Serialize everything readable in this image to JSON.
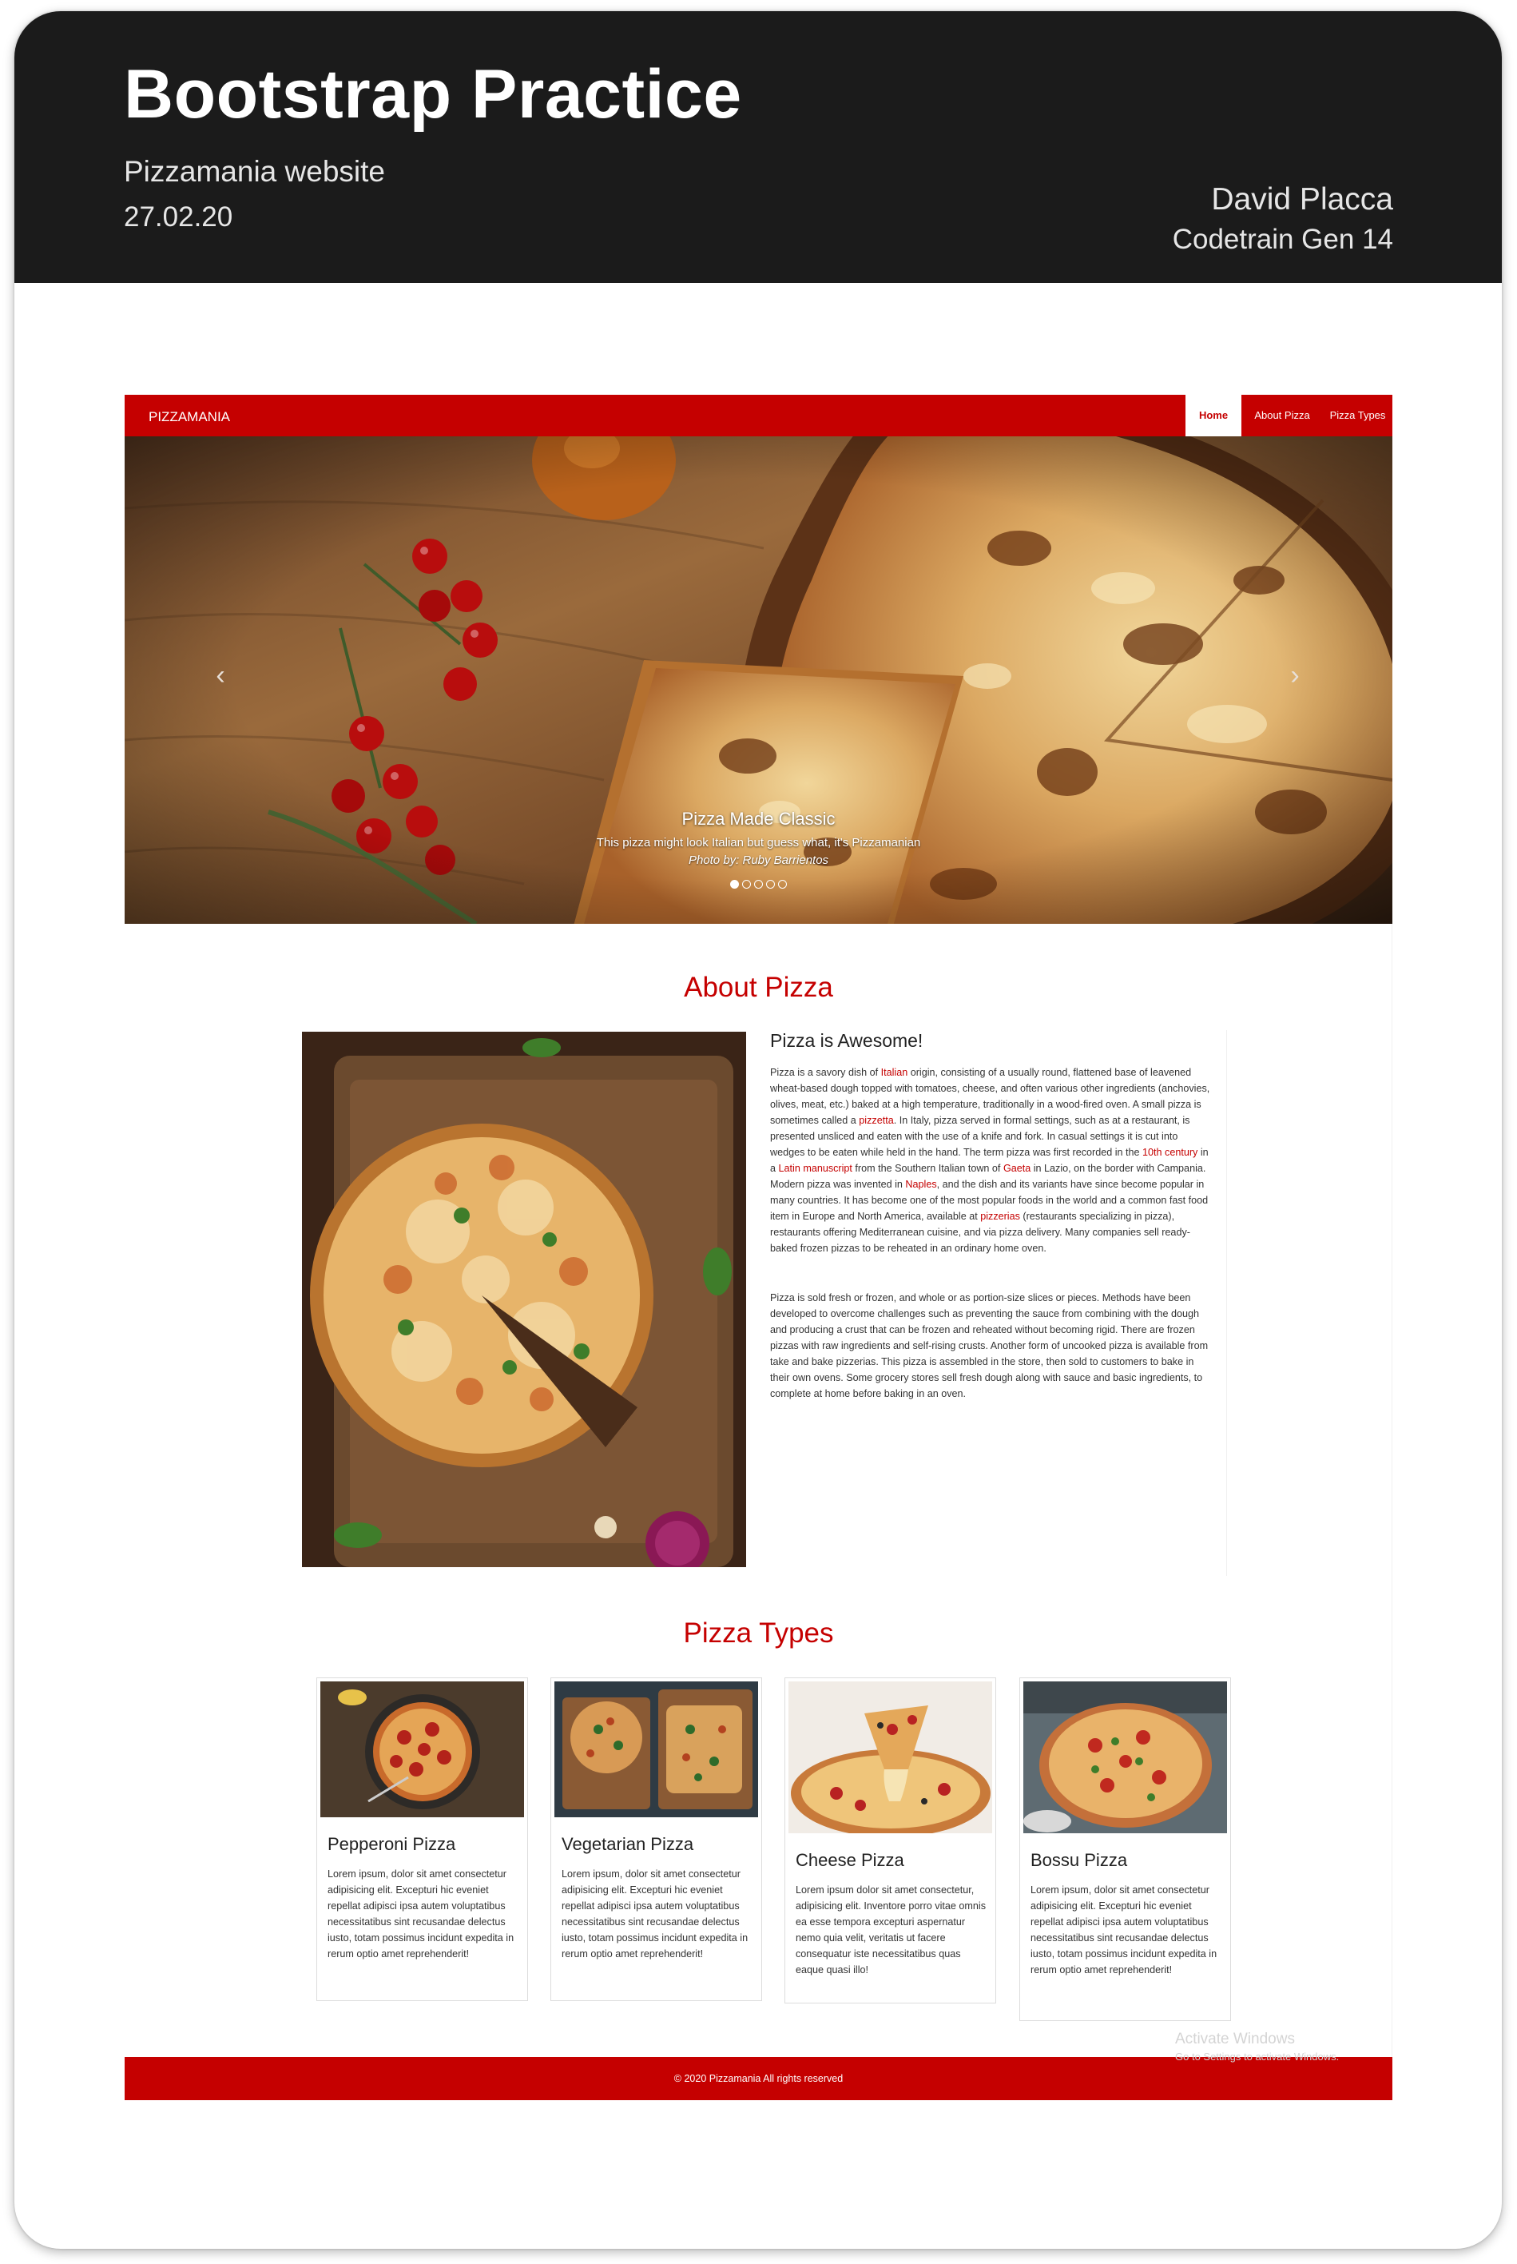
{
  "banner": {
    "title": "Bootstrap Practice",
    "subtitle": "Pizzamania website",
    "date": "27.02.20",
    "author": "David Placca",
    "org": "Codetrain Gen 14",
    "background": "#1b1b1b"
  },
  "site": {
    "accent": "#c50000",
    "brand": "PIZZAMANIA",
    "nav": [
      {
        "label": "Home",
        "active": true
      },
      {
        "label": "About Pizza",
        "active": false
      },
      {
        "label": "Pizza Types",
        "active": false
      }
    ],
    "carousel": {
      "caption_title": "Pizza Made Classic",
      "caption_text": "This pizza might look Italian but guess what, it's Pizzamanian",
      "caption_credit": "Photo by: Ruby Barrientos",
      "prev_icon": "chevron-left-icon",
      "next_icon": "chevron-right-icon",
      "slide_count": 5,
      "active_slide": 1
    },
    "about": {
      "title": "About Pizza",
      "heading": "Pizza is Awesome!",
      "p1": [
        {
          "t": "Pizza is a savory dish of "
        },
        {
          "t": "Italian",
          "link": true
        },
        {
          "t": " origin, consisting of a usually round, flattened base of leavened wheat-based dough topped with tomatoes, cheese, and often various other ingredients (anchovies, olives, meat, etc.) baked at a high temperature, traditionally in a wood-fired oven. A small pizza is sometimes called a "
        },
        {
          "t": "pizzetta",
          "link": true
        },
        {
          "t": ". In Italy, pizza served in formal settings, such as at a restaurant, is presented unsliced and eaten with the use of a knife and fork. In casual settings it is cut into wedges to be eaten while held in the hand. The term pizza was first recorded in the "
        },
        {
          "t": "10th century",
          "link": true
        },
        {
          "t": " in a "
        },
        {
          "t": "Latin manuscript",
          "link": true
        },
        {
          "t": " from the Southern Italian town of "
        },
        {
          "t": "Gaeta",
          "link": true
        },
        {
          "t": " in Lazio, on the border with Campania. Modern pizza was invented in "
        },
        {
          "t": "Naples",
          "link": true
        },
        {
          "t": ", and the dish and its variants have since become popular in many countries. It has become one of the most popular foods in the world and a common fast food item in Europe and North America, available at "
        },
        {
          "t": "pizzerias",
          "link": true
        },
        {
          "t": " (restaurants specializing in pizza), restaurants offering Mediterranean cuisine, and via pizza delivery. Many companies sell ready-baked frozen pizzas to be reheated in an ordinary home oven."
        }
      ],
      "p2": "Pizza is sold fresh or frozen, and whole or as portion-size slices or pieces. Methods have been developed to overcome challenges such as preventing the sauce from combining with the dough and producing a crust that can be frozen and reheated without becoming rigid. There are frozen pizzas with raw ingredients and self-rising crusts. Another form of uncooked pizza is available from take and bake pizzerias. This pizza is assembled in the store, then sold to customers to bake in their own ovens. Some grocery stores sell fresh dough along with sauce and basic ingredients, to complete at home before baking in an oven."
    },
    "types": {
      "title": "Pizza Types",
      "items": [
        {
          "name": "Pepperoni Pizza",
          "desc": "Lorem ipsum, dolor sit amet consectetur adipisicing elit. Excepturi hic eveniet repellat adipisci ipsa autem voluptatibus necessitatibus sint recusandae delectus iusto, totam possimus incidunt expedita in rerum optio amet reprehenderit!"
        },
        {
          "name": "Vegetarian Pizza",
          "desc": "Lorem ipsum, dolor sit amet consectetur adipisicing elit. Excepturi hic eveniet repellat adipisci ipsa autem voluptatibus necessitatibus sint recusandae delectus iusto, totam possimus incidunt expedita in rerum optio amet reprehenderit!"
        },
        {
          "name": "Cheese Pizza",
          "desc": "Lorem ipsum dolor sit amet consectetur, adipisicing elit. Inventore porro vitae omnis ea esse tempora excepturi aspernatur nemo quia velit, veritatis ut facere consequatur iste necessitatibus quas eaque quasi illo!"
        },
        {
          "name": "Bossu Pizza",
          "desc": "Lorem ipsum, dolor sit amet consectetur adipisicing elit. Excepturi hic eveniet repellat adipisci ipsa autem voluptatibus necessitatibus sint recusandae delectus iusto, totam possimus incidunt expedita in rerum optio amet reprehenderit!"
        }
      ]
    },
    "footer": "© 2020 Pizzamania All rights reserved"
  },
  "watermark": {
    "line1": "Activate Windows",
    "line2": "Go to Settings to activate Windows."
  }
}
